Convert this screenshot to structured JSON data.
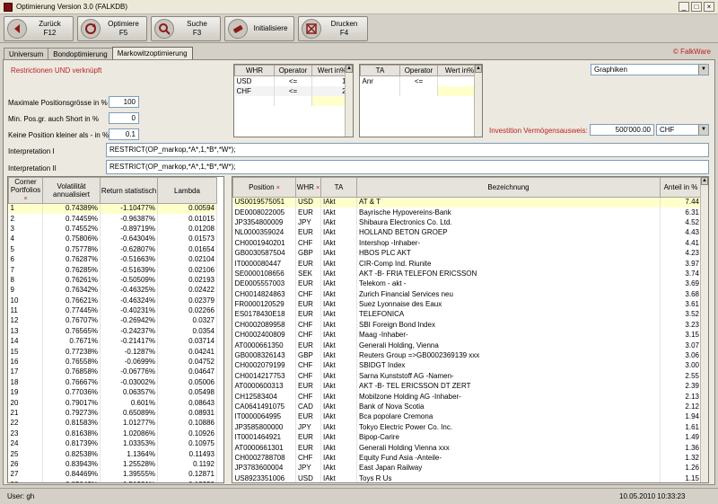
{
  "window": {
    "title": "Optimierung Version 3.0  (FALKDB)"
  },
  "toolbar": {
    "buttons": [
      {
        "label": "Zurück",
        "key": "F12"
      },
      {
        "label": "Optimiere",
        "key": "F5"
      },
      {
        "label": "Suche",
        "key": "F3"
      },
      {
        "label": "Initialisiere",
        "key": ""
      },
      {
        "label": "Drucken",
        "key": "F4"
      }
    ]
  },
  "tabs": [
    "Universum",
    "Bondoptimierung",
    "Markowitzoptimierung"
  ],
  "copyright": "© FalkWare",
  "form": {
    "restrictions_note": "Restrictionen UND verknüpft",
    "max_pos_label": "Maximale Positionsgrösse in %",
    "max_pos_value": "100",
    "min_pos_label": "Min. Pos.gr. auch Short in %",
    "min_pos_value": "0",
    "no_pos_label": "Keine Position kleiner als - in %",
    "no_pos_value": "0.1",
    "interp1_label": "Interpretation I",
    "interp1_value": "RESTRICT(OP_markop,*A*,1,*B*,*W*);",
    "interp2_label": "Interpretation II",
    "interp2_value": "RESTRICT(OP_markop,*A*,1,*B*,*W*);",
    "invest_label": "Investition Vermögensausweis:",
    "invest_value": "500'000.00",
    "currency": "CHF",
    "graph_select": "Graphiken"
  },
  "whr_grid": {
    "headers": [
      "WHR",
      "Operator",
      "Wert in%"
    ],
    "rows": [
      [
        "USD",
        "<=",
        "10"
      ],
      [
        "CHF",
        "<=",
        "25"
      ]
    ]
  },
  "ta_grid": {
    "headers": [
      "TA",
      "Operator",
      "Wert in%"
    ],
    "rows": [
      [
        "Anr",
        "<=",
        "1"
      ]
    ]
  },
  "corner_grid": {
    "headers": {
      "cp": "Corner Portfolios",
      "vol": "Volatilität annualisiert",
      "ret": "Return statistisch",
      "lambda": "Lambda"
    },
    "rows": [
      [
        "1",
        "0.74389%",
        "-1.10477%",
        "0.00594"
      ],
      [
        "2",
        "0.74459%",
        "-0.96387%",
        "0.01015"
      ],
      [
        "3",
        "0.74552%",
        "-0.89719%",
        "0.01208"
      ],
      [
        "4",
        "0.75806%",
        "-0.64304%",
        "0.01573"
      ],
      [
        "5",
        "0.75778%",
        "-0.62807%",
        "0.01654"
      ],
      [
        "6",
        "0.76287%",
        "-0.51663%",
        "0.02104"
      ],
      [
        "7",
        "0.76285%",
        "-0.51639%",
        "0.02106"
      ],
      [
        "8",
        "0.76261%",
        "-0.50509%",
        "0.02193"
      ],
      [
        "9",
        "0.76342%",
        "-0.46325%",
        "0.02422"
      ],
      [
        "10",
        "0.76621%",
        "-0.46324%",
        "0.02379"
      ],
      [
        "11",
        "0.77445%",
        "-0.40231%",
        "0.02266"
      ],
      [
        "12",
        "0.76707%",
        "-0.26942%",
        "0.0327"
      ],
      [
        "13",
        "0.76565%",
        "-0.24237%",
        "0.0354"
      ],
      [
        "14",
        "0.7671%",
        "-0.21417%",
        "0.03714"
      ],
      [
        "15",
        "0.77238%",
        "-0.1287%",
        "0.04241"
      ],
      [
        "16",
        "0.76558%",
        "-0.0699%",
        "0.04752"
      ],
      [
        "17",
        "0.76858%",
        "-0.06776%",
        "0.04647"
      ],
      [
        "18",
        "0.76667%",
        "-0.03002%",
        "0.05006"
      ],
      [
        "19",
        "0.77036%",
        "0.06357%",
        "0.05498"
      ],
      [
        "20",
        "0.79017%",
        "0.601%",
        "0.08643"
      ],
      [
        "21",
        "0.79273%",
        "0.65089%",
        "0.08931"
      ],
      [
        "22",
        "0.81583%",
        "1.01277%",
        "0.10886"
      ],
      [
        "23",
        "0.81638%",
        "1.02086%",
        "0.10926"
      ],
      [
        "24",
        "0.81739%",
        "1.03353%",
        "0.10975"
      ],
      [
        "25",
        "0.82538%",
        "1.1364%",
        "0.11493"
      ],
      [
        "26",
        "0.83943%",
        "1.25528%",
        "0.1192"
      ],
      [
        "27",
        "0.84469%",
        "1.39555%",
        "0.12871"
      ],
      [
        "28",
        "0.85042%",
        "1.51331%",
        "0.13259"
      ],
      [
        "29",
        "0.85166%",
        "1.52095%",
        "0.1332"
      ]
    ]
  },
  "position_grid": {
    "headers": {
      "pos": "Position",
      "whr": "WHR",
      "ta": "TA",
      "bez": "Bezeichnung",
      "anteil": "Anteil in %"
    },
    "rows": [
      [
        "US0019575051",
        "USD",
        "IAkt",
        "AT & T",
        "7.44"
      ],
      [
        "DE0008022005",
        "EUR",
        "IAkt",
        "Bayrische Hypovereins-Bank",
        "6.31"
      ],
      [
        "JP3354800009",
        "JPY",
        "IAkt",
        "Shibaura Electronics Co. Ltd.",
        "4.52"
      ],
      [
        "NL0000359024",
        "EUR",
        "IAkt",
        "HOLLAND BETON GROEP",
        "4.43"
      ],
      [
        "CH0001940201",
        "CHF",
        "IAkt",
        "Intershop  -Inhaber-",
        "4.41"
      ],
      [
        "GB0030587504",
        "GBP",
        "IAkt",
        "HBOS PLC AKT",
        "4.23"
      ],
      [
        "IT0000080447",
        "EUR",
        "IAkt",
        "CIR-Comp Ind. Riunite",
        "3.97"
      ],
      [
        "SE0000108656",
        "SEK",
        "IAkt",
        "AKT -B- FRIA TELEFON ERICSSON",
        "3.74"
      ],
      [
        "DE0005557003",
        "EUR",
        "IAkt",
        "Telekom  - akt -",
        "3.69"
      ],
      [
        "CH0014824863",
        "CHF",
        "IAkt",
        "Zurich Financial Services neu",
        "3.68"
      ],
      [
        "FR0000120529",
        "EUR",
        "IAkt",
        "Suez Lyonnaise des Eaux",
        "3.61"
      ],
      [
        "ES0178430E18",
        "EUR",
        "IAkt",
        "TELEFONICA",
        "3.52"
      ],
      [
        "CH0002089958",
        "CHF",
        "IAkt",
        "SBI Foreign Bond Index",
        "3.23"
      ],
      [
        "CH0002400809",
        "CHF",
        "IAkt",
        "Maag  -Inhaber-",
        "3.15"
      ],
      [
        "AT0000661350",
        "EUR",
        "IAkt",
        "Generali Holding, Vienna",
        "3.07"
      ],
      [
        "GB0008326143",
        "GBP",
        "IAkt",
        "Reuters Group =>GB0002369139 xxx",
        "3.06"
      ],
      [
        "CH0002079199",
        "CHF",
        "IAkt",
        "SBIDGT Index",
        "3.00"
      ],
      [
        "CH0014217753",
        "CHF",
        "IAkt",
        "Sarna Kunststoff AG -Namen-",
        "2.55"
      ],
      [
        "AT0000600313",
        "EUR",
        "IAkt",
        "AKT -B- TEL ERICSSON DT ZERT",
        "2.39"
      ],
      [
        "CH12583404",
        "CHF",
        "IAkt",
        "Mobilzone Holding AG  -Inhaber-",
        "2.13"
      ],
      [
        "CA0641491075",
        "CAD",
        "IAkt",
        "Bank of Nova Scotia",
        "2.12"
      ],
      [
        "IT0000064995",
        "EUR",
        "IAkt",
        "Bca popolare Cremona",
        "1.94"
      ],
      [
        "JP3585800000",
        "JPY",
        "IAkt",
        "Tokyo Electric Power Co. Inc.",
        "1.61"
      ],
      [
        "IT0001464921",
        "EUR",
        "IAkt",
        "Bipop-Carire",
        "1.49"
      ],
      [
        "AT0000661301",
        "EUR",
        "IAkt",
        "Generali Holding Vienna xxx",
        "1.36"
      ],
      [
        "CH0002788708",
        "CHF",
        "IAkt",
        "Equity Fund Asia  -Anteile-",
        "1.32"
      ],
      [
        "JP3783600004",
        "JPY",
        "IAkt",
        "East Japan Railway",
        "1.26"
      ],
      [
        "US8923351006",
        "USD",
        "IAkt",
        "Toys R Us",
        "1.15"
      ],
      [
        "GB0031348658",
        "GBP",
        "IAkt",
        "Barclays",
        "1.14"
      ]
    ]
  },
  "status": {
    "user": "User: gh",
    "datetime": "10.05.2010 10:33:23"
  }
}
